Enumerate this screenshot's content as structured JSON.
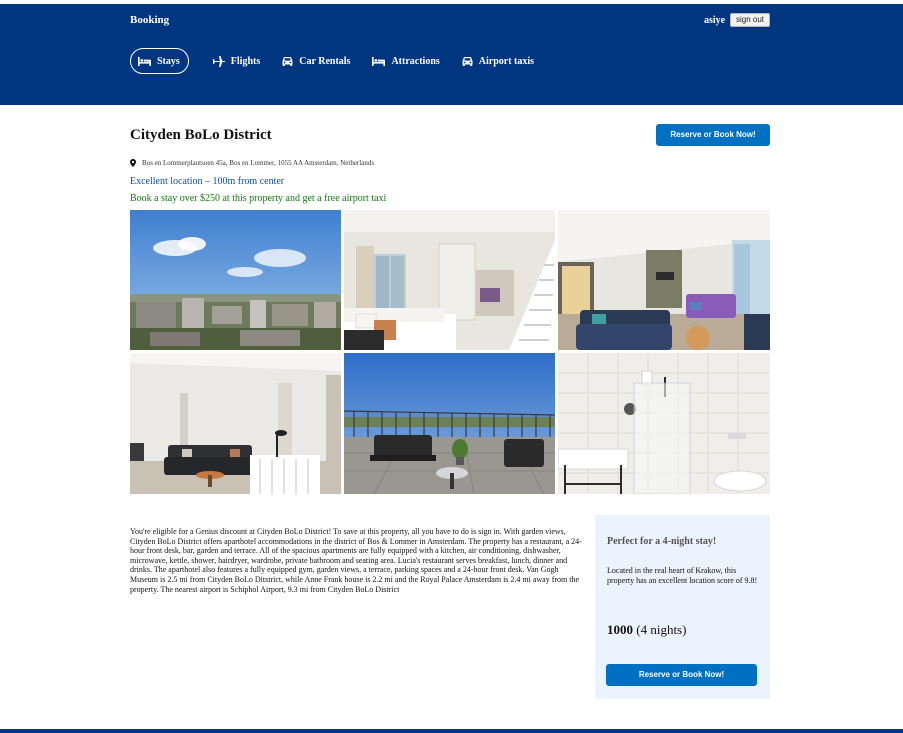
{
  "header": {
    "brand": "Booking",
    "username": "asiye",
    "signout_label": "sign out",
    "nav": [
      {
        "label": "Stays",
        "icon": "bed-icon",
        "active": true
      },
      {
        "label": "Flights",
        "icon": "plane-icon",
        "active": false
      },
      {
        "label": "Car Rentals",
        "icon": "car-icon",
        "active": false
      },
      {
        "label": "Attractions",
        "icon": "bed-icon",
        "active": false
      },
      {
        "label": "Airport taxis",
        "icon": "car-icon",
        "active": false
      }
    ]
  },
  "property": {
    "name": "Cityden BoLo District",
    "reserve_label": "Reserve or Book Now!",
    "address": "Bos en Lommerplantsoen 45a, Bos en Lommer, 1055 AA Amsterdam, Netherlands",
    "location_note": "Excellent location – 100m from center",
    "promo": "Book a stay over $250 at this property and get a free airport taxi",
    "photos": [
      "city-view",
      "bedroom",
      "living-room",
      "lounge",
      "terrace",
      "bathroom"
    ],
    "description": "You're eligible for a Genius discount at Cityden BoLo District! To save at this property, all you have to do is sign in. With garden views, Cityden BoLo District offers aparthotel accommodations in the district of Bos & Lommer in Amsterdam. The property has a restaurant, a 24-hour front desk, bar, garden and terrace. All of the spacious apartments are fully equipped with a kitchen, air conditioning, dishwasher, microwave, kettle, shower, hairdryer, wardrobe, private bathroom and seating area. Lucia's restaurant serves breakfast, lunch, dinner and drinks. The aparthotel also features a fully equipped gym, garden views, a terrace, parking spaces and a 24-hour front desk. Van Gogh Museum is 2.5 mi from Cityden BoLo Ditstrict, while Anne Frank house is 2.2 mi and the Royal Palace Amsterdam is 2.4 mi away from the property. The nearest airport is Schiphol Airport, 9.3 mi from Cityden BoLo District"
  },
  "sidebox": {
    "title": "Perfect for a 4-night stay!",
    "text": "Located in the real heart of Krakow, this property has an excellent location score of 9.8!",
    "price": "1000",
    "nights": "(4 nights)",
    "reserve_label": "Reserve or Book Now!"
  },
  "colors": {
    "brand_blue": "#003580",
    "button_blue": "#0071c2",
    "link_blue": "#0b4f9c",
    "promo_green": "#127b0d",
    "sidebox_bg": "#ebf3ff"
  }
}
